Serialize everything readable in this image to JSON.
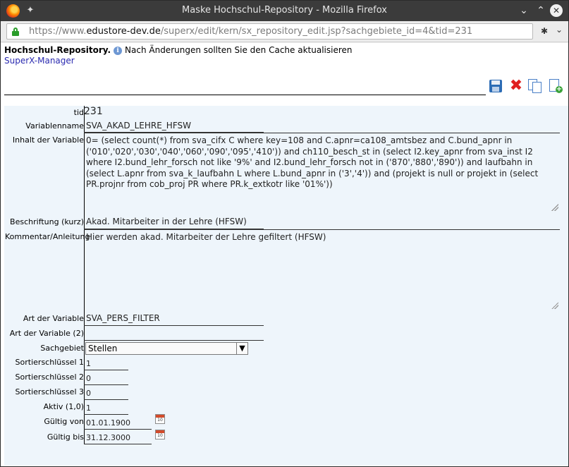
{
  "window": {
    "title": "Maske Hochschul-Repository - Mozilla Firefox"
  },
  "urlbar": {
    "prefix": "https://www.",
    "host": "edustore-dev.de",
    "path": "/superx/edit/kern/sx_repository_edit.jsp?sachgebiete_id=4&tid=231"
  },
  "header": {
    "title": "Hochschul-Repository.",
    "notice": "Nach Änderungen sollten Sie den Cache aktualisieren",
    "manager_link": "SuperX-Manager"
  },
  "icons": {
    "save": "save-icon",
    "delete": "delete-icon",
    "copy": "copy-icon",
    "new": "new-record-icon",
    "info": "info-icon",
    "calendar": "calendar-icon"
  },
  "form": {
    "tid": {
      "label": "tid",
      "value": "231"
    },
    "variablenname": {
      "label": "Variablenname",
      "value": "SVA_AKAD_LEHRE_HFSW"
    },
    "inhalt": {
      "label": "Inhalt der Variable",
      "value": "0= (select count(*) from sva_cifx C where key=108 and C.apnr=ca108_amtsbez and C.bund_apnr in ('010','020','030','040','060','090','095','410')) and ch110_besch_st in (select I2.key_apnr from sva_inst I2 where I2.bund_lehr_forsch not like '9%' and I2.bund_lehr_forsch not in ('870','880','890')) and laufbahn in (select L.apnr from sva_k_laufbahn L where L.bund_apnr in ('3','4')) and (projekt is null or projekt in (select PR.projnr from cob_proj PR where PR.k_extkotr like '01%'))"
    },
    "beschriftung": {
      "label": "Beschriftung (kurz)",
      "value": "Akad. Mitarbeiter in der Lehre (HFSW)"
    },
    "kommentar": {
      "label": "Kommentar/Anleitung",
      "value": "Hier werden akad. Mitarbeiter der Lehre gefiltert (HFSW)"
    },
    "art": {
      "label": "Art der Variable",
      "value": "SVA_PERS_FILTER"
    },
    "art2": {
      "label": "Art der Variable (2)",
      "value": ""
    },
    "sachgebiet": {
      "label": "Sachgebiet",
      "value": "Stellen"
    },
    "sort1": {
      "label": "Sortierschlüssel 1",
      "value": "1"
    },
    "sort2": {
      "label": "Sortierschlüssel 2",
      "value": "0"
    },
    "sort3": {
      "label": "Sortierschlüssel 3",
      "value": "0"
    },
    "aktiv": {
      "label": "Aktiv (1,0)",
      "value": "1"
    },
    "gueltig_von": {
      "label": "Gültig von",
      "value": "01.01.1900"
    },
    "gueltig_bis": {
      "label": "Gültig bis",
      "value": "31.12.3000"
    },
    "calendar_day": "10"
  }
}
